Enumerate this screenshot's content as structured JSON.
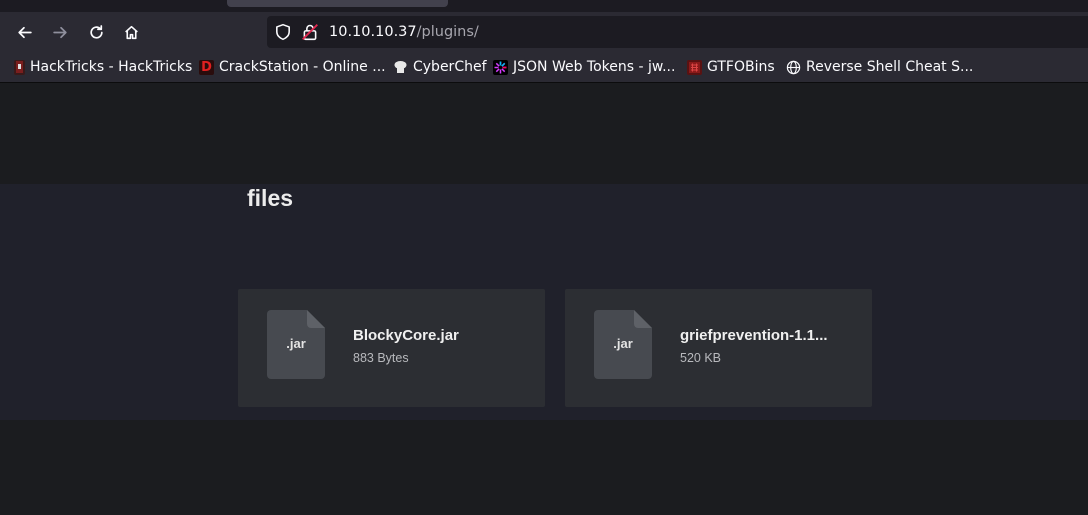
{
  "browser": {
    "url_host": "10.10.10.37",
    "url_path": "/plugins/",
    "nav_icons": [
      "back-icon",
      "forward-icon",
      "reload-icon",
      "home-icon"
    ],
    "bookmarks": [
      {
        "label": "HackTricks - HackTricks",
        "icon": "hacktricks-icon"
      },
      {
        "label": "CrackStation - Online ...",
        "icon": "crackstation-icon",
        "glyph": "D"
      },
      {
        "label": "CyberChef",
        "icon": "cyberchef-icon"
      },
      {
        "label": "JSON Web Tokens - jw...",
        "icon": "jwt-icon"
      },
      {
        "label": "GTFOBins",
        "icon": "gtfobins-icon"
      },
      {
        "label": "Reverse Shell Cheat S...",
        "icon": "globe-icon"
      }
    ]
  },
  "page": {
    "title": "files",
    "files": [
      {
        "ext": ".jar",
        "name": "BlockyCore.jar",
        "size": "883 Bytes"
      },
      {
        "ext": ".jar",
        "name": "griefprevention-1.1...",
        "size": "520 KB"
      }
    ]
  },
  "colors": {
    "toolbar": "#2b2a33",
    "page_band": "#20212b",
    "card": "#2c2e33",
    "file_icon": "#474a50"
  }
}
